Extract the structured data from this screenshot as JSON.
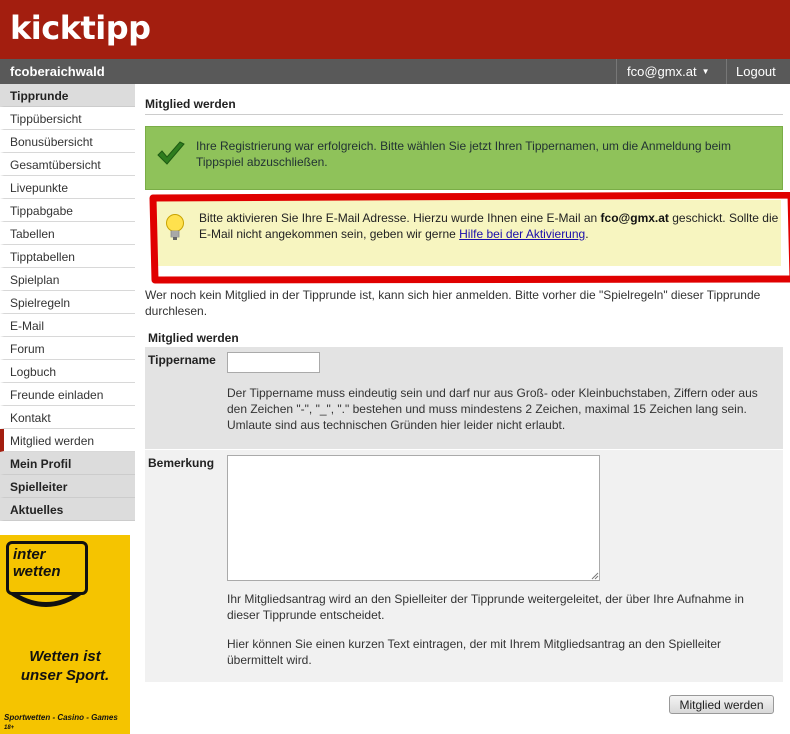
{
  "header": {
    "logo": "kicktipp",
    "group_name": "fcoberaichwald",
    "user_email": "fco@gmx.at",
    "logout_label": "Logout"
  },
  "sidebar": {
    "items": [
      {
        "label": "Tipprunde",
        "type": "section"
      },
      {
        "label": "Tippübersicht",
        "type": "item"
      },
      {
        "label": "Bonusübersicht",
        "type": "item"
      },
      {
        "label": "Gesamtübersicht",
        "type": "item"
      },
      {
        "label": "Livepunkte",
        "type": "item"
      },
      {
        "label": "Tippabgabe",
        "type": "item"
      },
      {
        "label": "Tabellen",
        "type": "item"
      },
      {
        "label": "Tipptabellen",
        "type": "item"
      },
      {
        "label": "Spielplan",
        "type": "item"
      },
      {
        "label": "Spielregeln",
        "type": "item"
      },
      {
        "label": "E-Mail",
        "type": "item"
      },
      {
        "label": "Forum",
        "type": "item"
      },
      {
        "label": "Logbuch",
        "type": "item"
      },
      {
        "label": "Freunde einladen",
        "type": "item"
      },
      {
        "label": "Kontakt",
        "type": "item"
      },
      {
        "label": "Mitglied werden",
        "type": "active"
      },
      {
        "label": "Mein Profil",
        "type": "section"
      },
      {
        "label": "Spielleiter",
        "type": "section"
      },
      {
        "label": "Aktuelles",
        "type": "section"
      }
    ]
  },
  "ad": {
    "logo_line1": "inter",
    "logo_line2": "wetten",
    "slogan_line1": "Wetten ist",
    "slogan_line2": "unser Sport.",
    "footer": "Sportwetten - Casino - Games",
    "age": "18+"
  },
  "main": {
    "title": "Mitglied werden",
    "success_message": "Ihre Registrierung war erfolgreich. Bitte wählen Sie jetzt Ihren Tippernamen, um die Anmeldung beim Tippspiel abzuschließen.",
    "info_part1": "Bitte aktivieren Sie Ihre E-Mail Adresse. Hierzu wurde Ihnen eine E-Mail an ",
    "info_email": "fco@gmx.at",
    "info_part2": " geschickt. Sollte die E-Mail nicht angekommen sein, geben wir gerne ",
    "info_link": "Hilfe bei der Aktivierung",
    "info_part3": ".",
    "intro": "Wer noch kein Mitglied in der Tipprunde ist, kann sich hier anmelden. Bitte vorher die \"Spielregeln\" dieser Tipprunde durchlesen."
  },
  "form": {
    "heading": "Mitglied werden",
    "tippername_label": "Tippername",
    "tippername_value": "",
    "tippername_help": "Der Tippername muss eindeutig sein und darf nur aus Groß- oder Kleinbuchstaben, Ziffern oder aus den Zeichen \"-\", \"_\", \".\" bestehen und muss mindestens 2 Zeichen, maximal 15 Zeichen lang sein. Umlaute sind aus technischen Gründen hier leider nicht erlaubt.",
    "bemerkung_label": "Bemerkung",
    "bemerkung_value": "",
    "bemerkung_help1": "Ihr Mitgliedsantrag wird an den Spielleiter der Tipprunde weitergeleitet, der über Ihre Aufnahme in dieser Tipprunde entscheidet.",
    "bemerkung_help2": "Hier können Sie einen kurzen Text eintragen, der mit Ihrem Mitgliedsantrag an den Spielleiter übermittelt wird.",
    "submit_label": "Mitglied werden"
  },
  "colors": {
    "brand_red": "#a31e0f",
    "navbar": "#595959",
    "success_green": "#8fc25a",
    "info_yellow": "#f7f5c0",
    "highlight_red": "#e00000",
    "ad_yellow": "#f5c400"
  },
  "icons": {
    "success": "checkmark-icon",
    "info": "lightbulb-icon",
    "user_menu": "caret-down-icon"
  }
}
